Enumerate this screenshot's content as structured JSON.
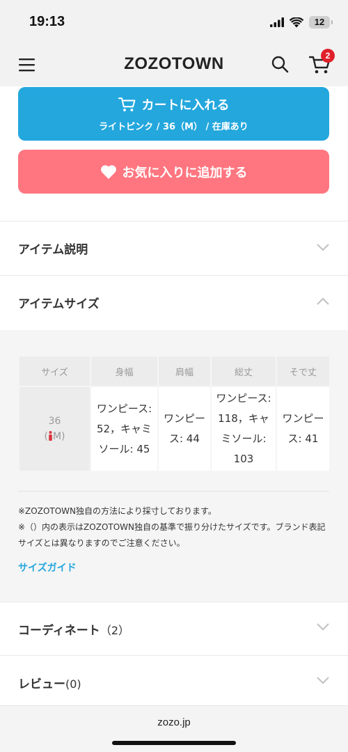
{
  "status_bar": {
    "time": "19:13",
    "battery": "12",
    "icons": [
      "signal-icon",
      "wifi-icon",
      "battery-icon"
    ]
  },
  "header": {
    "logo": "ZOZOTOWN",
    "icons": [
      "menu-icon",
      "search-icon",
      "cart-icon"
    ],
    "cart_badge": "2"
  },
  "cart_button": {
    "label": "カートに入れる",
    "sub_label": "ライトピンク / 36（M） / 在庫あり",
    "color": "#23a7dd"
  },
  "favorite_button": {
    "label": "お気に入りに追加する",
    "color": "#ff7680"
  },
  "sections": {
    "item_description": {
      "label": "アイテム説明",
      "expanded": false
    },
    "item_size": {
      "label": "アイテムサイズ",
      "expanded": true
    },
    "coordinate": {
      "label": "コーディネート",
      "count": "（2）",
      "expanded": false
    },
    "review": {
      "label": "レビュー",
      "count": "(0)",
      "expanded": false
    }
  },
  "size_table": {
    "headers": [
      "サイズ",
      "身幅",
      "肩幅",
      "総丈",
      "そで丈"
    ],
    "rows": [
      {
        "size": "36",
        "size_sub_left": "(",
        "size_icon": "person-icon",
        "size_sub_right": "M)",
        "cells": [
          "ワンピース: 52，キャミソール: 45",
          "ワンピース: 44",
          "ワンピース: 118，キャミソール: 103",
          "ワンピース: 41"
        ]
      }
    ]
  },
  "notes": [
    "※ZOZOTOWN独自の方法により採寸しております。",
    "※（）内の表示はZOZOTOWN独自の基準で振り分けたサイズです。ブランド表記サイズとは異なりますのでご注意ください。"
  ],
  "size_guide_link": "サイズガイド",
  "browser": {
    "url": "zozo.jp"
  },
  "colors": {
    "accent_blue": "#23a7dd",
    "accent_pink": "#ff7680",
    "badge_red": "#e0202a"
  }
}
